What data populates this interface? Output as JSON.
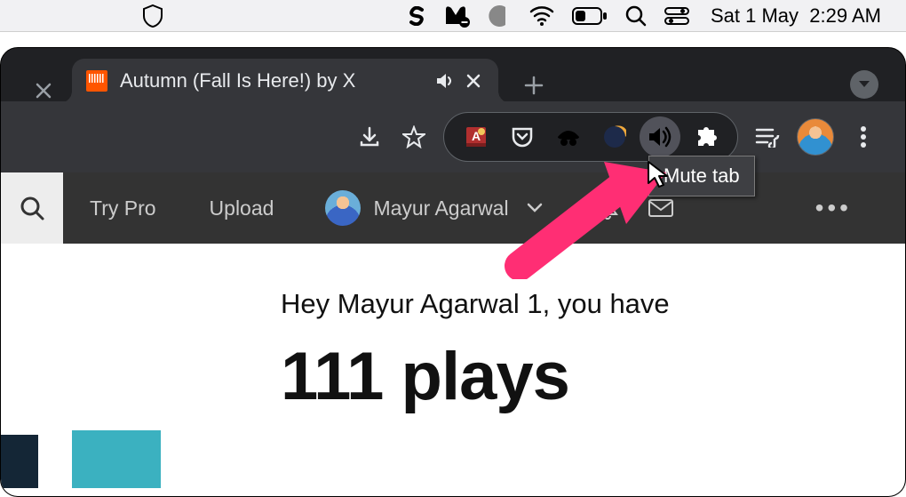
{
  "menubar": {
    "date": "Sat 1 May",
    "time": "2:29 AM"
  },
  "browser": {
    "tab": {
      "title": "Autumn (Fall Is Here!) by X"
    },
    "tooltip": "Mute tab"
  },
  "sc": {
    "nav": {
      "try_pro": "Try Pro",
      "upload": "Upload",
      "user": "Mayur Agarwal"
    },
    "greeting": "Hey Mayur Agarwal 1, you have",
    "plays": "111 plays",
    "more": "•••"
  }
}
